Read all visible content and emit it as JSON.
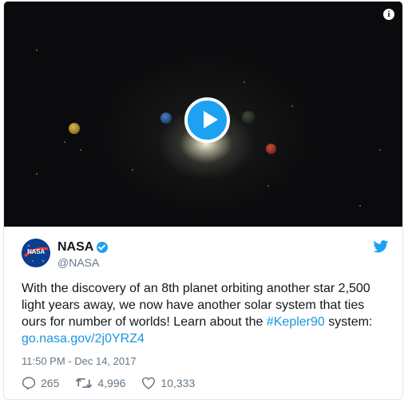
{
  "video": {
    "info_icon": "info-icon",
    "play_icon": "play-icon"
  },
  "tweet": {
    "author_name": "NASA",
    "author_handle": "@NASA",
    "avatar_text": "NASA",
    "verified": true,
    "text_part1": "With the discovery of an 8th planet orbiting another star 2,500 light years away, we now have another solar system that ties ours for number of worlds! Learn about the ",
    "hashtag": "#Kepler90",
    "text_part2": " system: ",
    "link": "go.nasa.gov/2j0YRZ4",
    "timestamp": "11:50 PM - Dec 14, 2017"
  },
  "actions": {
    "replies": "265",
    "retweets": "4,996",
    "likes": "10,333"
  },
  "colors": {
    "accent": "#1da1f2",
    "link": "#1b95e0",
    "text": "#14171a",
    "muted": "#657786"
  }
}
